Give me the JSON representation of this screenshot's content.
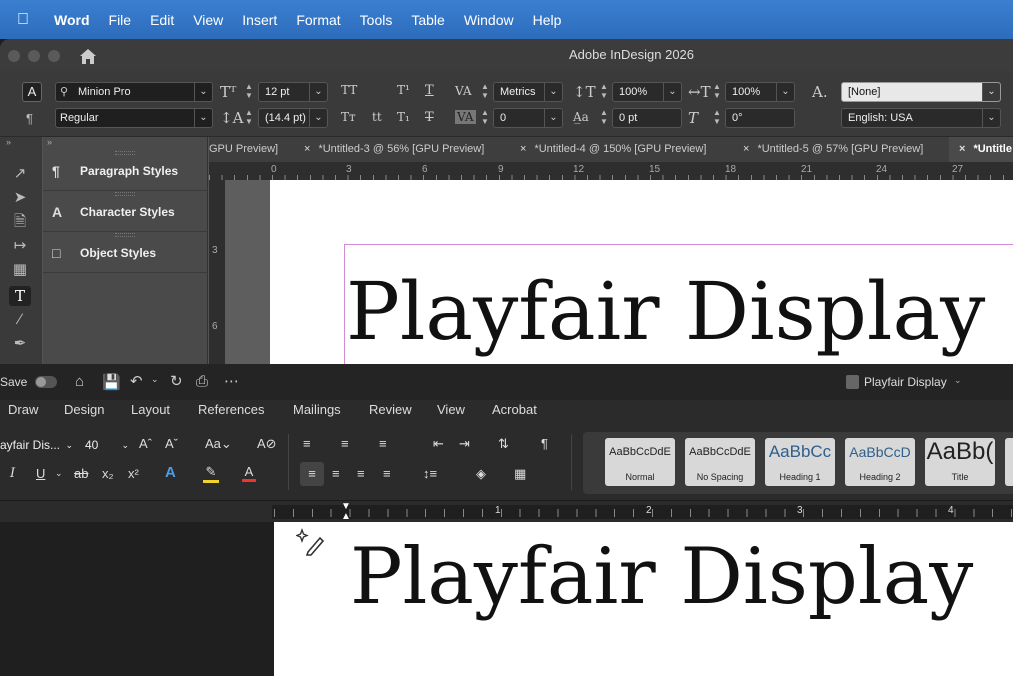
{
  "menubar": {
    "app": "Word",
    "items": [
      "File",
      "Edit",
      "View",
      "Insert",
      "Format",
      "Tools",
      "Table",
      "Window",
      "Help"
    ]
  },
  "indesign": {
    "window_title": "Adobe InDesign 2026",
    "control": {
      "font_family": "Minion Pro",
      "font_style": "Regular",
      "font_size": "12 pt",
      "leading": "(14.4 pt)",
      "kerning": "Metrics",
      "tracking": "0",
      "vertical_scale": "100%",
      "horizontal_scale": "100%",
      "baseline_shift": "0 pt",
      "skew": "0°",
      "char_style": "[None]",
      "language": "English: USA"
    },
    "panels": [
      "Paragraph Styles",
      "Character Styles",
      "Object Styles"
    ],
    "tabs": [
      {
        "label": "GPU Preview]",
        "active": false
      },
      {
        "label": "*Untitled-3 @ 56% [GPU Preview]",
        "active": false
      },
      {
        "label": "*Untitled-4 @ 150% [GPU Preview]",
        "active": false
      },
      {
        "label": "*Untitled-5 @ 57% [GPU Preview]",
        "active": false
      },
      {
        "label": "*Untitle",
        "active": true
      }
    ],
    "ruler_h": [
      "0",
      "3",
      "6",
      "9",
      "12",
      "15",
      "18",
      "21",
      "24",
      "27"
    ],
    "ruler_v": [
      "3",
      "6"
    ],
    "document_text": "Playfair Display"
  },
  "word": {
    "save_label": "Save",
    "doc_title": "Playfair Display",
    "tabs": [
      "Draw",
      "Design",
      "Layout",
      "References",
      "Mailings",
      "Review",
      "View",
      "Acrobat"
    ],
    "font_name": "ayfair Dis...",
    "font_size": "40",
    "styles": [
      {
        "sample": "AaBbCcDdE",
        "name": "Normal"
      },
      {
        "sample": "AaBbCcDdE",
        "name": "No Spacing"
      },
      {
        "sample": "AaBbCc",
        "name": "Heading 1"
      },
      {
        "sample": "AaBbCcD",
        "name": "Heading 2"
      },
      {
        "sample": "AaBb(",
        "name": "Title"
      }
    ],
    "ruler": [
      "1",
      "2",
      "3",
      "4"
    ],
    "document_text": "Playfair Display"
  },
  "colors": {
    "menubar": "#2d6cbc",
    "heading_blue": "#2f5f8a",
    "frame_guide": "#d58ad5"
  }
}
